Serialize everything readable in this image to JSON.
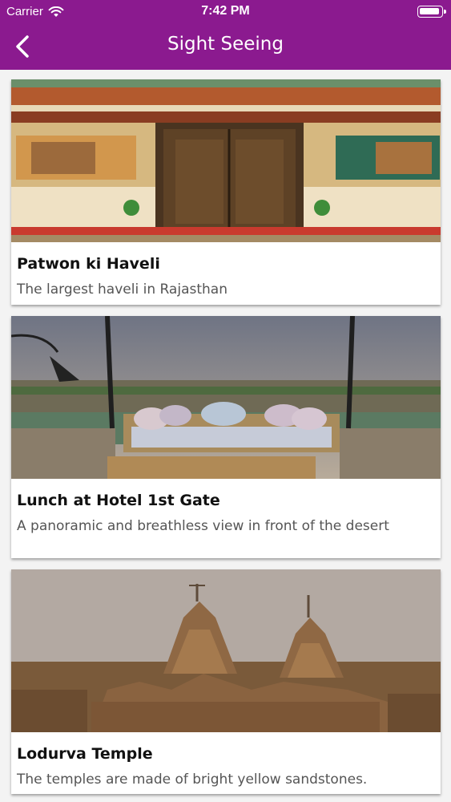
{
  "status_bar": {
    "carrier": "Carrier",
    "time": "7:42 PM"
  },
  "nav": {
    "title": "Sight Seeing"
  },
  "places": [
    {
      "title": "Patwon ki Haveli",
      "description": "The largest haveli in Rajasthan"
    },
    {
      "title": "Lunch at Hotel 1st Gate",
      "description": "A panoramic and breathless view in front of the desert"
    },
    {
      "title": "Lodurva Temple",
      "description": "The temples are made of bright yellow sandstones."
    }
  ],
  "colors": {
    "accent": "#8b1a8f"
  }
}
